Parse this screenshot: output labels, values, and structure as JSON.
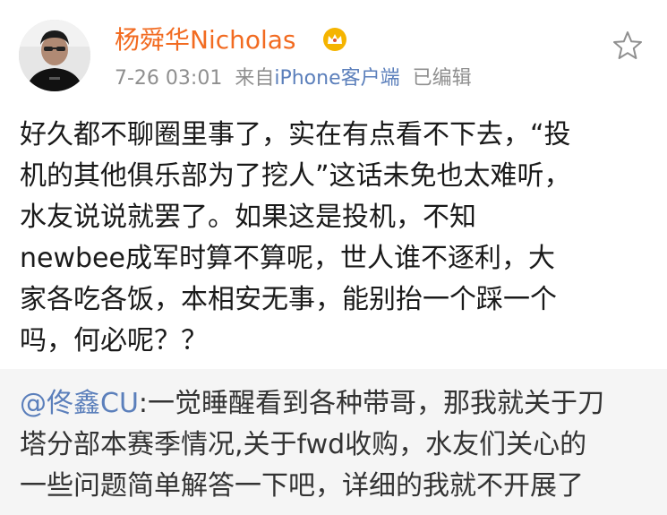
{
  "post": {
    "author": "杨舜华Nicholas",
    "badge_icon": "crown-icon",
    "time": "7-26 03:01",
    "source_prefix": "来自",
    "source": "iPhone客户端",
    "edited": "已编辑",
    "favorite_icon": "star-icon",
    "body_lines": [
      "好久都不聊圈里事了，实在有点看不下去，“投",
      "机的其他俱乐部为了挖人”这话未免也太难听，",
      "水友说说就罢了。如果这是投机，不知",
      "newbee成军时算不算呢，世人谁不逐利，大",
      "家各吃各饭，本相安无事，能别抬一个踩一个",
      "吗，何必呢？？"
    ]
  },
  "repost": {
    "mention": "@佟鑫CU",
    "first_line_rest": ":一觉睡醒看到各种带哥，那我就关于刀",
    "lines": [
      "塔分部本赛季情况,关于fwd收购，水友们关心的",
      "一些问题简单解答一下吧，详细的我就不开展了"
    ]
  },
  "colors": {
    "author": "#f26b21",
    "link": "#5b7fbb",
    "meta": "#8f8f8f",
    "repost_bg": "#f5f5f5",
    "badge": "#f5b400"
  }
}
